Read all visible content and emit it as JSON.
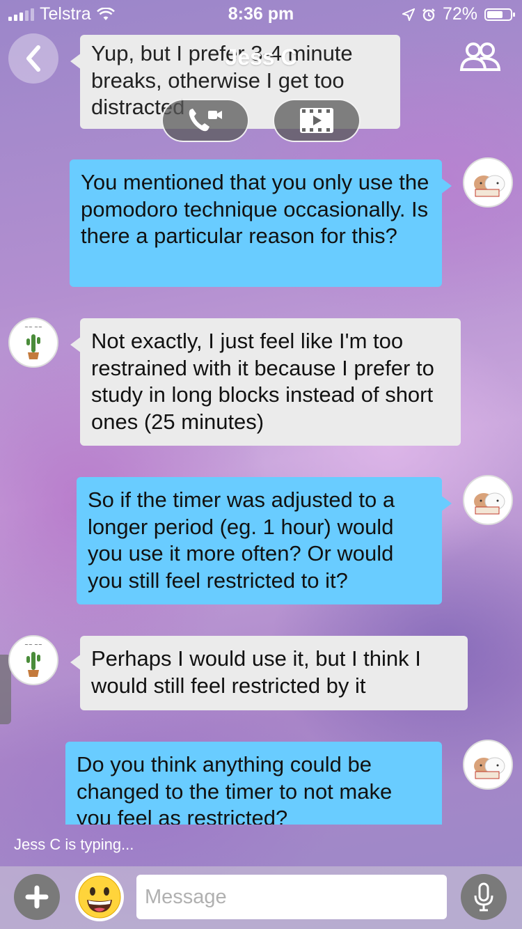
{
  "status_bar": {
    "carrier": "Telstra",
    "time": "8:36 pm",
    "battery_percent": "72%",
    "battery_level": 0.72
  },
  "header": {
    "title": "Jess C",
    "back_icon": "chevron-left-icon",
    "members_icon": "people-icon",
    "call_icon": "phone-video-icon",
    "video_icon": "film-play-icon"
  },
  "messages": [
    {
      "from": "Jess C",
      "text": "Yup, but I prefer 3-4 minute breaks, otherwise I get too distracted"
    },
    {
      "from": "me",
      "text": "You mentioned that you only use the pomodoro technique occasionally. Is there a particular reason for this?"
    },
    {
      "from": "Jess C",
      "text": "Not exactly, I just feel like I'm too restrained with it because I prefer to study in long blocks instead of short ones (25 minutes)"
    },
    {
      "from": "me",
      "text": "So if the timer was adjusted to a longer period (eg. 1 hour) would you use it more often? Or would you still feel restricted to it?"
    },
    {
      "from": "Jess C",
      "text": "Perhaps I would use it, but I think I would still feel restricted by it"
    },
    {
      "from": "me",
      "text": "Do you think anything could be changed to the timer to not make you feel as restricted?"
    }
  ],
  "typing_indicator": "Jess C is typing...",
  "composer": {
    "placeholder": "Message",
    "add_icon": "plus-icon",
    "emoji_icon": "grinning-emoji-icon",
    "mic_icon": "microphone-icon"
  },
  "colors": {
    "outgoing_bubble": "#69ccff",
    "incoming_bubble": "#ebebeb",
    "button_gray": "#7a7a7a"
  }
}
